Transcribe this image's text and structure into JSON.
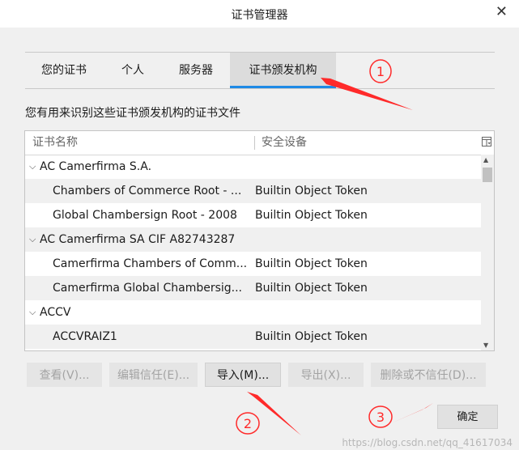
{
  "window": {
    "title": "证书管理器",
    "close_glyph": "✕"
  },
  "tabs": [
    {
      "label": "您的证书",
      "active": false
    },
    {
      "label": "个人",
      "active": false
    },
    {
      "label": "服务器",
      "active": false
    },
    {
      "label": "证书颁发机构",
      "active": true
    }
  ],
  "description": "您有用来识别这些证书颁发机构的证书文件",
  "table": {
    "headers": {
      "name": "证书名称",
      "device": "安全设备"
    },
    "rows": [
      {
        "group": true,
        "name": "AC Camerfirma S.A.",
        "device": ""
      },
      {
        "group": false,
        "name": "Chambers of Commerce Root - ...",
        "device": "Builtin Object Token"
      },
      {
        "group": false,
        "name": "Global Chambersign Root - 2008",
        "device": "Builtin Object Token"
      },
      {
        "group": true,
        "name": "AC Camerfirma SA CIF A82743287",
        "device": ""
      },
      {
        "group": false,
        "name": "Camerfirma Chambers of Comm...",
        "device": "Builtin Object Token"
      },
      {
        "group": false,
        "name": "Camerfirma Global Chambersig...",
        "device": "Builtin Object Token"
      },
      {
        "group": true,
        "name": "ACCV",
        "device": ""
      },
      {
        "group": false,
        "name": "ACCVRAIZ1",
        "device": "Builtin Object Token"
      },
      {
        "group": false,
        "name": "",
        "device": ""
      }
    ]
  },
  "buttons": {
    "view": "查看(V)...",
    "edit_trust": "编辑信任(E)...",
    "import": "导入(M)...",
    "export": "导出(X)...",
    "delete": "删除或不信任(D)...",
    "ok": "确定"
  },
  "annotations": {
    "n1": "1",
    "n2": "2",
    "n3": "3",
    "color": "#ff2a2a"
  },
  "watermark": "https://blog.csdn.net/qq_41617034"
}
